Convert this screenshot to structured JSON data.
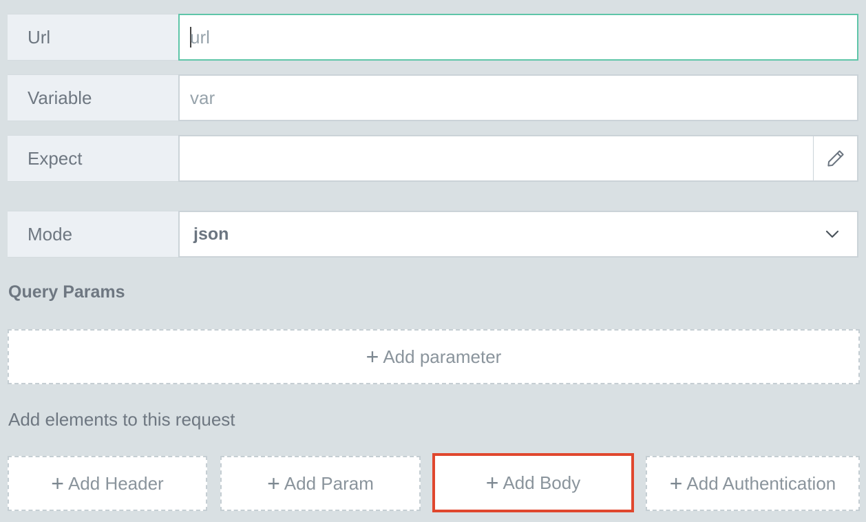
{
  "fields": {
    "url": {
      "label": "Url",
      "placeholder": "url",
      "value": ""
    },
    "variable": {
      "label": "Variable",
      "placeholder": "var",
      "value": ""
    },
    "expect": {
      "label": "Expect",
      "value": ""
    },
    "mode": {
      "label": "Mode",
      "value": "json"
    }
  },
  "query_params": {
    "title": "Query Params",
    "add_label": "Add parameter"
  },
  "elements": {
    "hint": "Add elements to this request",
    "buttons": [
      {
        "label": "Add Header"
      },
      {
        "label": "Add Param"
      },
      {
        "label": "Add Body"
      },
      {
        "label": "Add Authentication"
      }
    ]
  },
  "icons": {
    "edit": "pencil-icon",
    "dropdown": "chevron-down-icon",
    "add": "plus-icon"
  },
  "colors": {
    "background": "#d9e0e3",
    "focus_border": "#5ec5a8",
    "highlight": "#e0472e"
  }
}
